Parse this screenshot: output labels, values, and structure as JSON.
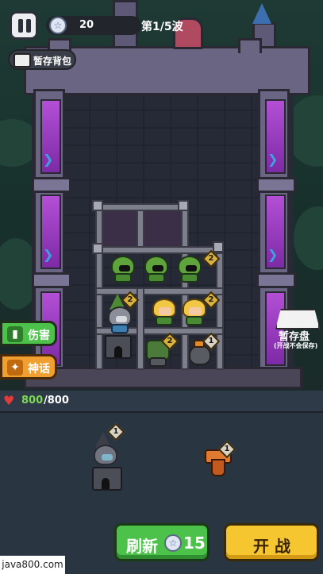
{
  "hud": {
    "pause_icon": "pause-icon",
    "coins": "20",
    "wave": "第1/5波",
    "stash_label": "暂存背包",
    "stash_icon": "backpack-icon"
  },
  "side_buttons": [
    {
      "label": "伤害",
      "icon": "bar-chart-icon",
      "color": "#4cc24a"
    },
    {
      "label": "神话",
      "icon": "myth-icon",
      "color": "#f0a030"
    }
  ],
  "storage": {
    "label": "暂存盘",
    "sub_label": "(开战不会保存)"
  },
  "shelf": {
    "row1": [
      {
        "level": "2"
      }
    ],
    "row2": [
      {
        "level": "2"
      },
      {
        "level": "2"
      }
    ],
    "row3": [
      {
        "level": "2"
      },
      {
        "level": "1"
      }
    ]
  },
  "hp": {
    "current": "800",
    "max": "/800"
  },
  "bench": [
    {
      "level": "1"
    },
    {
      "level": "1"
    }
  ],
  "buttons": {
    "refresh_label": "刷新",
    "refresh_cost": "15",
    "start_label": "开 战"
  },
  "watermark": "java800.com",
  "colors": {
    "accent_green": "#4cc24a",
    "accent_yellow": "#f5c62f",
    "hp_green": "#7ed957",
    "pillar_purple": "#b34fd6"
  }
}
